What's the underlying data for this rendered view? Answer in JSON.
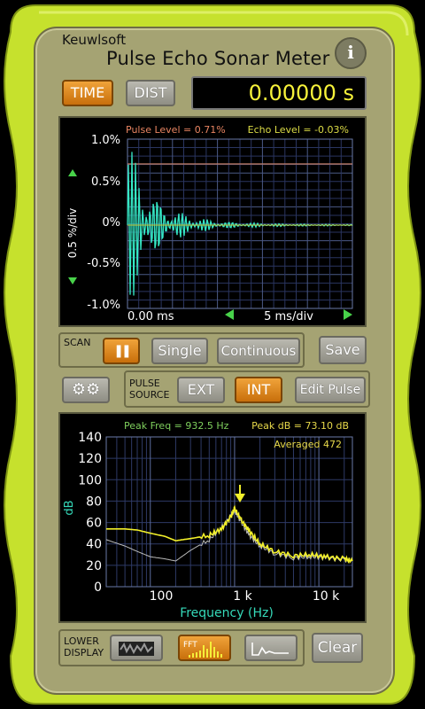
{
  "app": {
    "brand": "Keuwlsoft",
    "title": "Pulse Echo Sonar Meter",
    "info_label": "i"
  },
  "mode": {
    "time_label": "TIME",
    "dist_label": "DIST",
    "active": "TIME"
  },
  "readout": {
    "value": "0.00000 s"
  },
  "scope": {
    "pulse_level": "Pulse Level = 0.71%",
    "echo_level": "Echo Level = -0.03%",
    "y_ticks": [
      "1.0%",
      "0.5%",
      "0%",
      "-0.5%",
      "-1.0%"
    ],
    "y_label": "0.5 %/div",
    "x_start": "0.00 ms",
    "x_div": "5 ms/div"
  },
  "scan": {
    "label": "SCAN",
    "pause_label": "❚❚",
    "single_label": "Single",
    "continuous_label": "Continuous"
  },
  "save_label": "Save",
  "pulse_source": {
    "label_line1": "PULSE",
    "label_line2": "SOURCE",
    "ext_label": "EXT",
    "int_label": "INT",
    "active": "INT",
    "edit_label": "Edit Pulse"
  },
  "spectrum": {
    "peak_freq": "Peak Freq = 932.5 Hz",
    "peak_db": "Peak dB = 73.10 dB",
    "averaged": "Averaged 472",
    "y_label": "dB",
    "x_label": "Frequency (Hz)",
    "x_ticks": [
      "100",
      "1 k",
      "10 k"
    ]
  },
  "chart_data": {
    "type": "line",
    "title": "",
    "xlabel": "Frequency (Hz)",
    "ylabel": "dB",
    "x_scale": "log",
    "xlim": [
      30,
      25000
    ],
    "ylim": [
      0,
      140
    ],
    "y_ticks": [
      0,
      20,
      40,
      60,
      80,
      100,
      120,
      140
    ],
    "grid": true,
    "series": [
      {
        "color": "#f2f02a",
        "x": [
          30,
          50,
          70,
          100,
          150,
          200,
          300,
          500,
          700,
          900,
          1000,
          1200,
          1500,
          2000,
          3000,
          5000,
          8000,
          12000,
          20000,
          25000
        ],
        "y": [
          54,
          54,
          53,
          50,
          47,
          43,
          45,
          48,
          54,
          65,
          73,
          62,
          52,
          40,
          33,
          29,
          30,
          28,
          26,
          24
        ]
      },
      {
        "color": "#bbbbbb",
        "x": [
          30,
          50,
          70,
          100,
          150,
          200,
          300,
          500,
          700,
          900,
          1000,
          1200,
          1500,
          2000,
          3000,
          5000,
          8000,
          12000,
          20000,
          25000
        ],
        "y": [
          44,
          38,
          33,
          28,
          26,
          24,
          34,
          44,
          55,
          66,
          71,
          60,
          48,
          38,
          31,
          27,
          28,
          27,
          25,
          24
        ]
      }
    ]
  },
  "lower_display": {
    "label_line1": "LOWER",
    "label_line2": "DISPLAY",
    "fft_label": "FFT",
    "clear_label": "Clear"
  },
  "colors": {
    "body": "#c7e22e",
    "panel": "#a5a373",
    "trace": "#35e8c5",
    "spectrum": "#f2f02a",
    "button_active": "#e8901f"
  }
}
